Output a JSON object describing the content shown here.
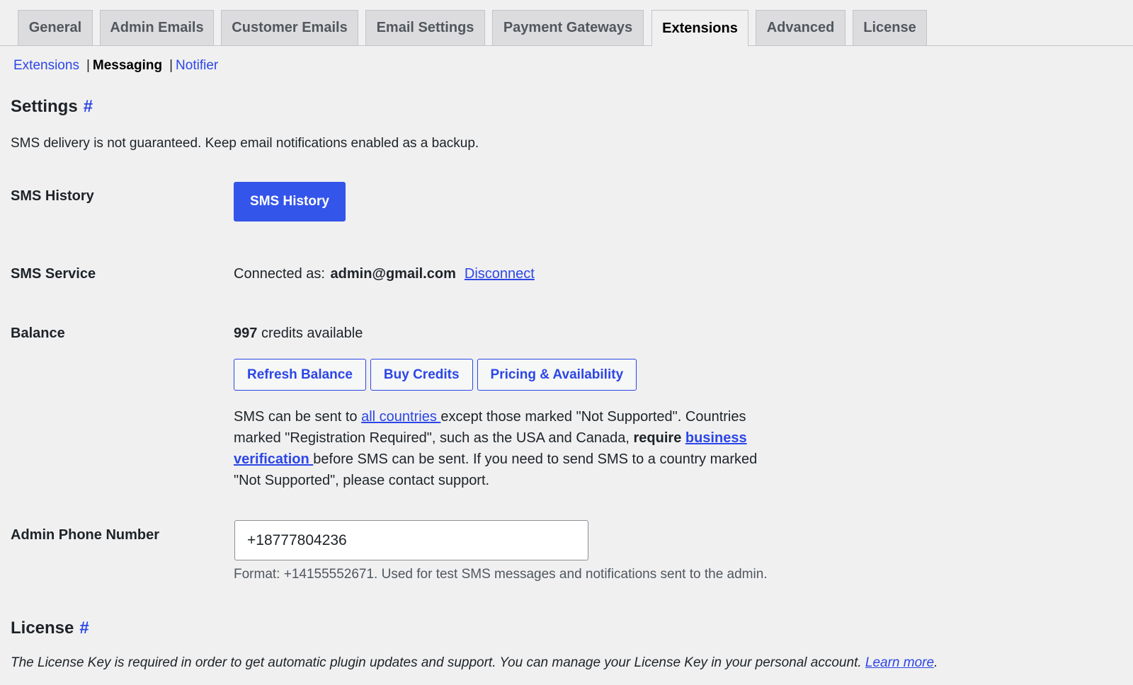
{
  "tabs": [
    {
      "label": "General",
      "active": false
    },
    {
      "label": "Admin Emails",
      "active": false
    },
    {
      "label": "Customer Emails",
      "active": false
    },
    {
      "label": "Email Settings",
      "active": false
    },
    {
      "label": "Payment Gateways",
      "active": false
    },
    {
      "label": "Extensions",
      "active": true
    },
    {
      "label": "Advanced",
      "active": false
    },
    {
      "label": "License",
      "active": false
    }
  ],
  "subnav": {
    "extensions": "Extensions",
    "separator": "|",
    "messaging": "Messaging",
    "notifier": "Notifier"
  },
  "settings": {
    "title": "Settings",
    "hash": "#",
    "description": "SMS delivery is not guaranteed. Keep email notifications enabled as a backup."
  },
  "sms_history": {
    "label": "SMS History",
    "button": "SMS History"
  },
  "sms_service": {
    "label": "SMS Service",
    "connected_prefix": "Connected as:",
    "email": "admin@gmail.com",
    "disconnect": "Disconnect"
  },
  "balance": {
    "label": "Balance",
    "credits": "997",
    "credits_suffix": "credits available",
    "buttons": {
      "refresh": "Refresh Balance",
      "buy": "Buy Credits",
      "pricing": "Pricing & Availability"
    },
    "info": {
      "part1": "SMS can be sent to ",
      "link1": "all countries ",
      "part2": "except those marked \"Not Supported\". Countries marked \"Registration Required\", such as the USA and Canada, ",
      "bold": "require ",
      "link2": "business verification ",
      "part3": "before SMS can be sent. If you need to send SMS to a country marked \"Not Supported\", please contact support."
    }
  },
  "admin_phone": {
    "label": "Admin Phone Number",
    "value": "+18777804236",
    "help": "Format: +14155552671. Used for test SMS messages and notifications sent to the admin."
  },
  "license": {
    "title": "License",
    "hash": "#",
    "description": "The License Key is required in order to get automatic plugin updates and support. You can manage your License Key in your personal account. ",
    "learn_more": "Learn more",
    "period": "."
  },
  "colors": {
    "accent": "#2c46e6",
    "primary_button": "#3455ea",
    "background": "#f0f0f1",
    "tab_inactive": "#dcdcde"
  }
}
